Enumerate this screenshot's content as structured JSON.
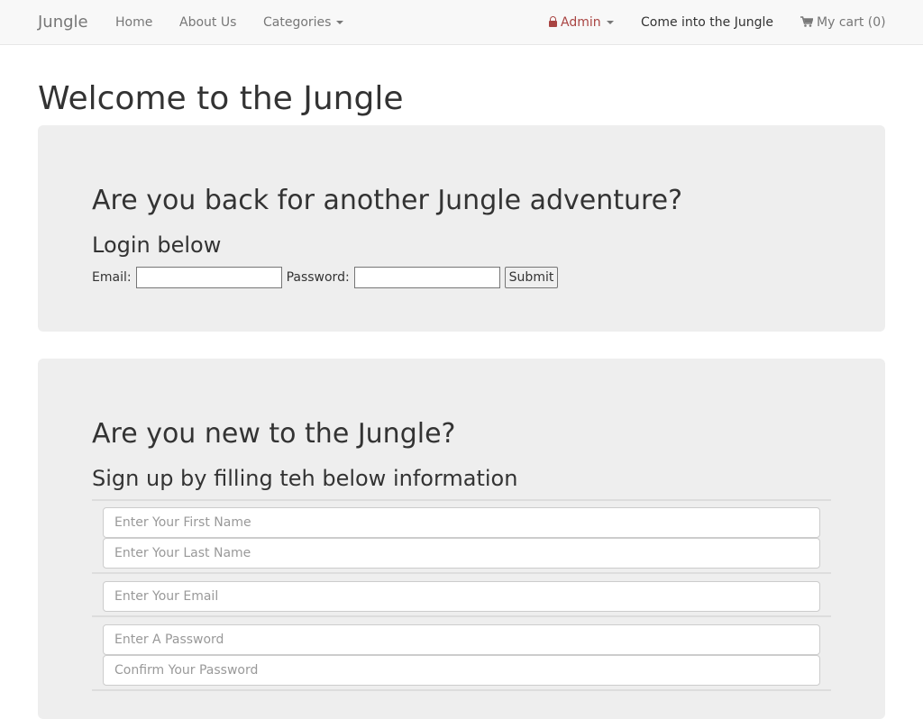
{
  "navbar": {
    "brand": "Jungle",
    "home": "Home",
    "about": "About Us",
    "categories": "Categories",
    "admin": "Admin",
    "login_link": "Come into the Jungle",
    "cart": "My cart (0)"
  },
  "page": {
    "title": "Welcome to the Jungle"
  },
  "login": {
    "heading": "Are you back for another Jungle adventure?",
    "subheading": "Login below",
    "email_label": "Email:",
    "password_label": "Password:",
    "submit_label": "Submit"
  },
  "signup": {
    "heading": "Are you new to the Jungle?",
    "subheading": "Sign up by filling teh below information",
    "first_name_placeholder": "Enter Your First Name",
    "last_name_placeholder": "Enter Your Last Name",
    "email_placeholder": "Enter Your Email",
    "password_placeholder": "Enter A Password",
    "confirm_password_placeholder": "Confirm Your Password"
  },
  "colors": {
    "navbar_bg": "#f8f8f8",
    "jumbotron_bg": "#eeeeee",
    "admin_accent": "#a94442"
  },
  "icons": {
    "admin": "lock-icon",
    "cart": "shopping-cart-icon",
    "dropdown": "caret-down-icon"
  }
}
